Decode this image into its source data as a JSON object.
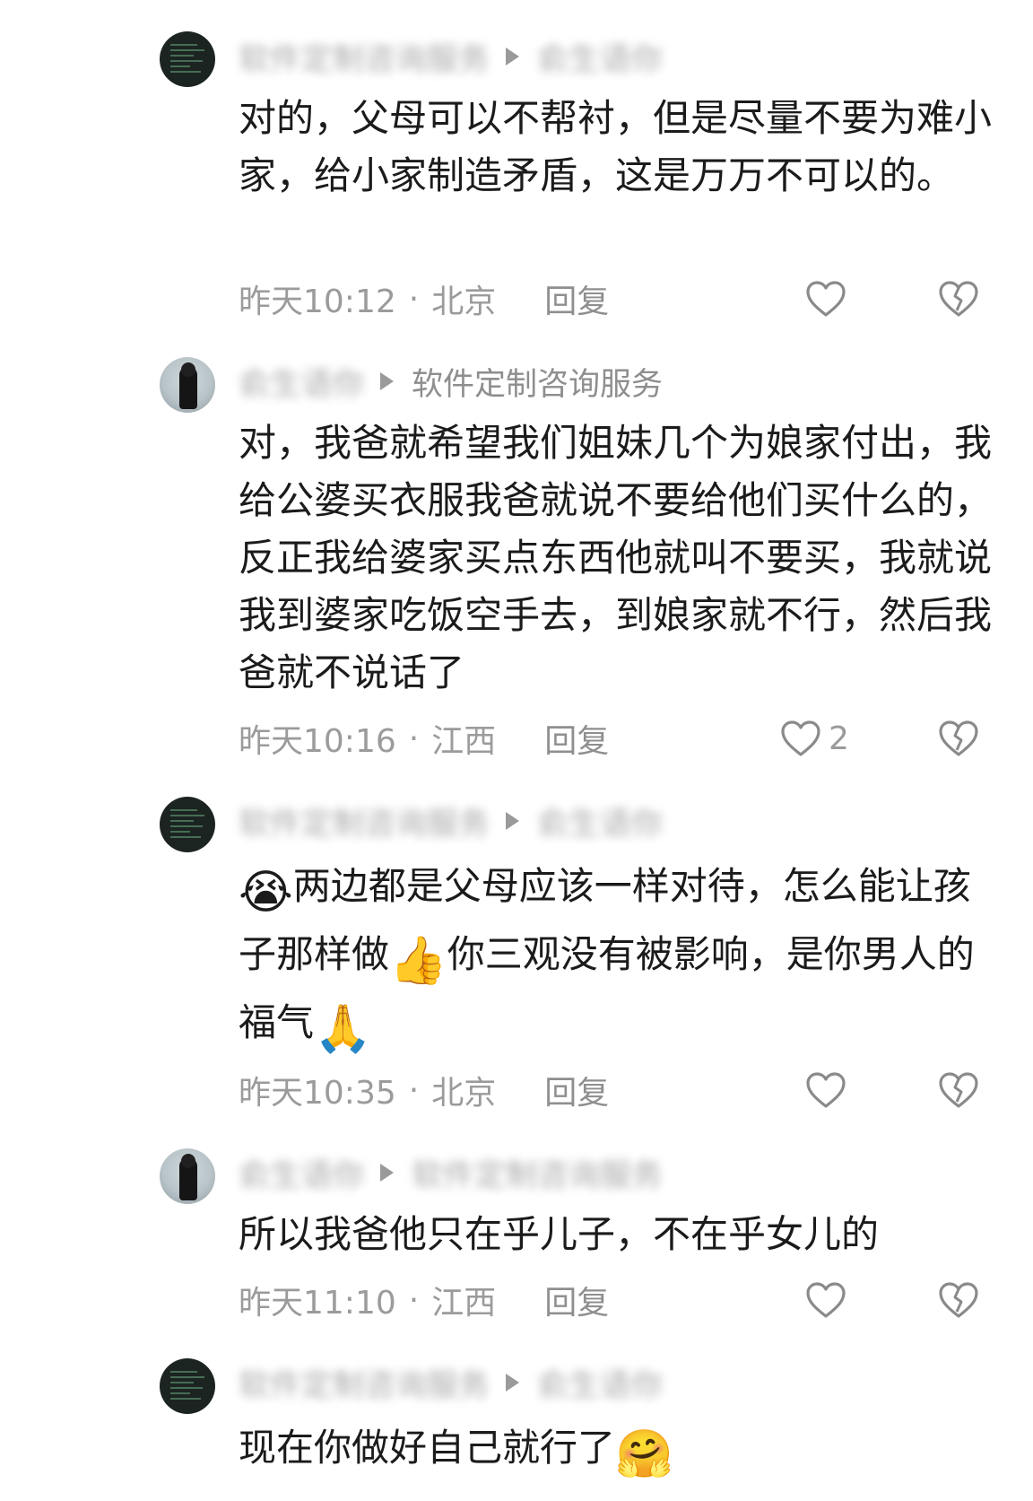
{
  "comments": [
    {
      "author": "软件定制咨询服务",
      "reply_to": "俞生语你",
      "text": "对的，父母可以不帮衬，但是尽量不要为难小家，给小家制造矛盾，这是万万不可以的。",
      "time": "昨天10:12",
      "location": "北京",
      "reply_label": "回复",
      "likes": "",
      "avatar": "dark-code"
    },
    {
      "author": "俞生语你",
      "reply_to": "软件定制咨询服务",
      "text": "对，我爸就希望我们姐妹几个为娘家付出，我给公婆买衣服我爸就说不要给他们买什么的，反正我给婆家买点东西他就叫不要买，我就说我到婆家吃饭空手去，到娘家就不行，然后我爸就不说话了",
      "time": "昨天10:16",
      "location": "江西",
      "reply_label": "回复",
      "likes": "2",
      "avatar": "photo"
    },
    {
      "author": "软件定制咨询服务",
      "reply_to": "俞生语你",
      "emoji_start": "😭",
      "text_a": "两边都是父母应该一样对待，怎么能让孩子那样做",
      "emoji_mid": "👍",
      "text_b": "你三观没有被影响，是你男人的福气",
      "emoji_end": "🙏",
      "time": "昨天10:35",
      "location": "北京",
      "reply_label": "回复",
      "likes": "",
      "avatar": "dark-code"
    },
    {
      "author": "俞生语你",
      "reply_to": "软件定制咨询服务",
      "text": "所以我爸他只在乎儿子，不在乎女儿的",
      "time": "昨天11:10",
      "location": "江西",
      "reply_label": "回复",
      "likes": "",
      "avatar": "photo"
    },
    {
      "author": "软件定制咨询服务",
      "reply_to": "俞生语你",
      "text": "现在你做好自己就行了",
      "emoji_end": "🤗",
      "avatar": "dark-code"
    }
  ],
  "icons": {
    "like": "heart-outline-icon",
    "dislike": "broken-heart-icon",
    "separator": "play-arrow-icon"
  }
}
